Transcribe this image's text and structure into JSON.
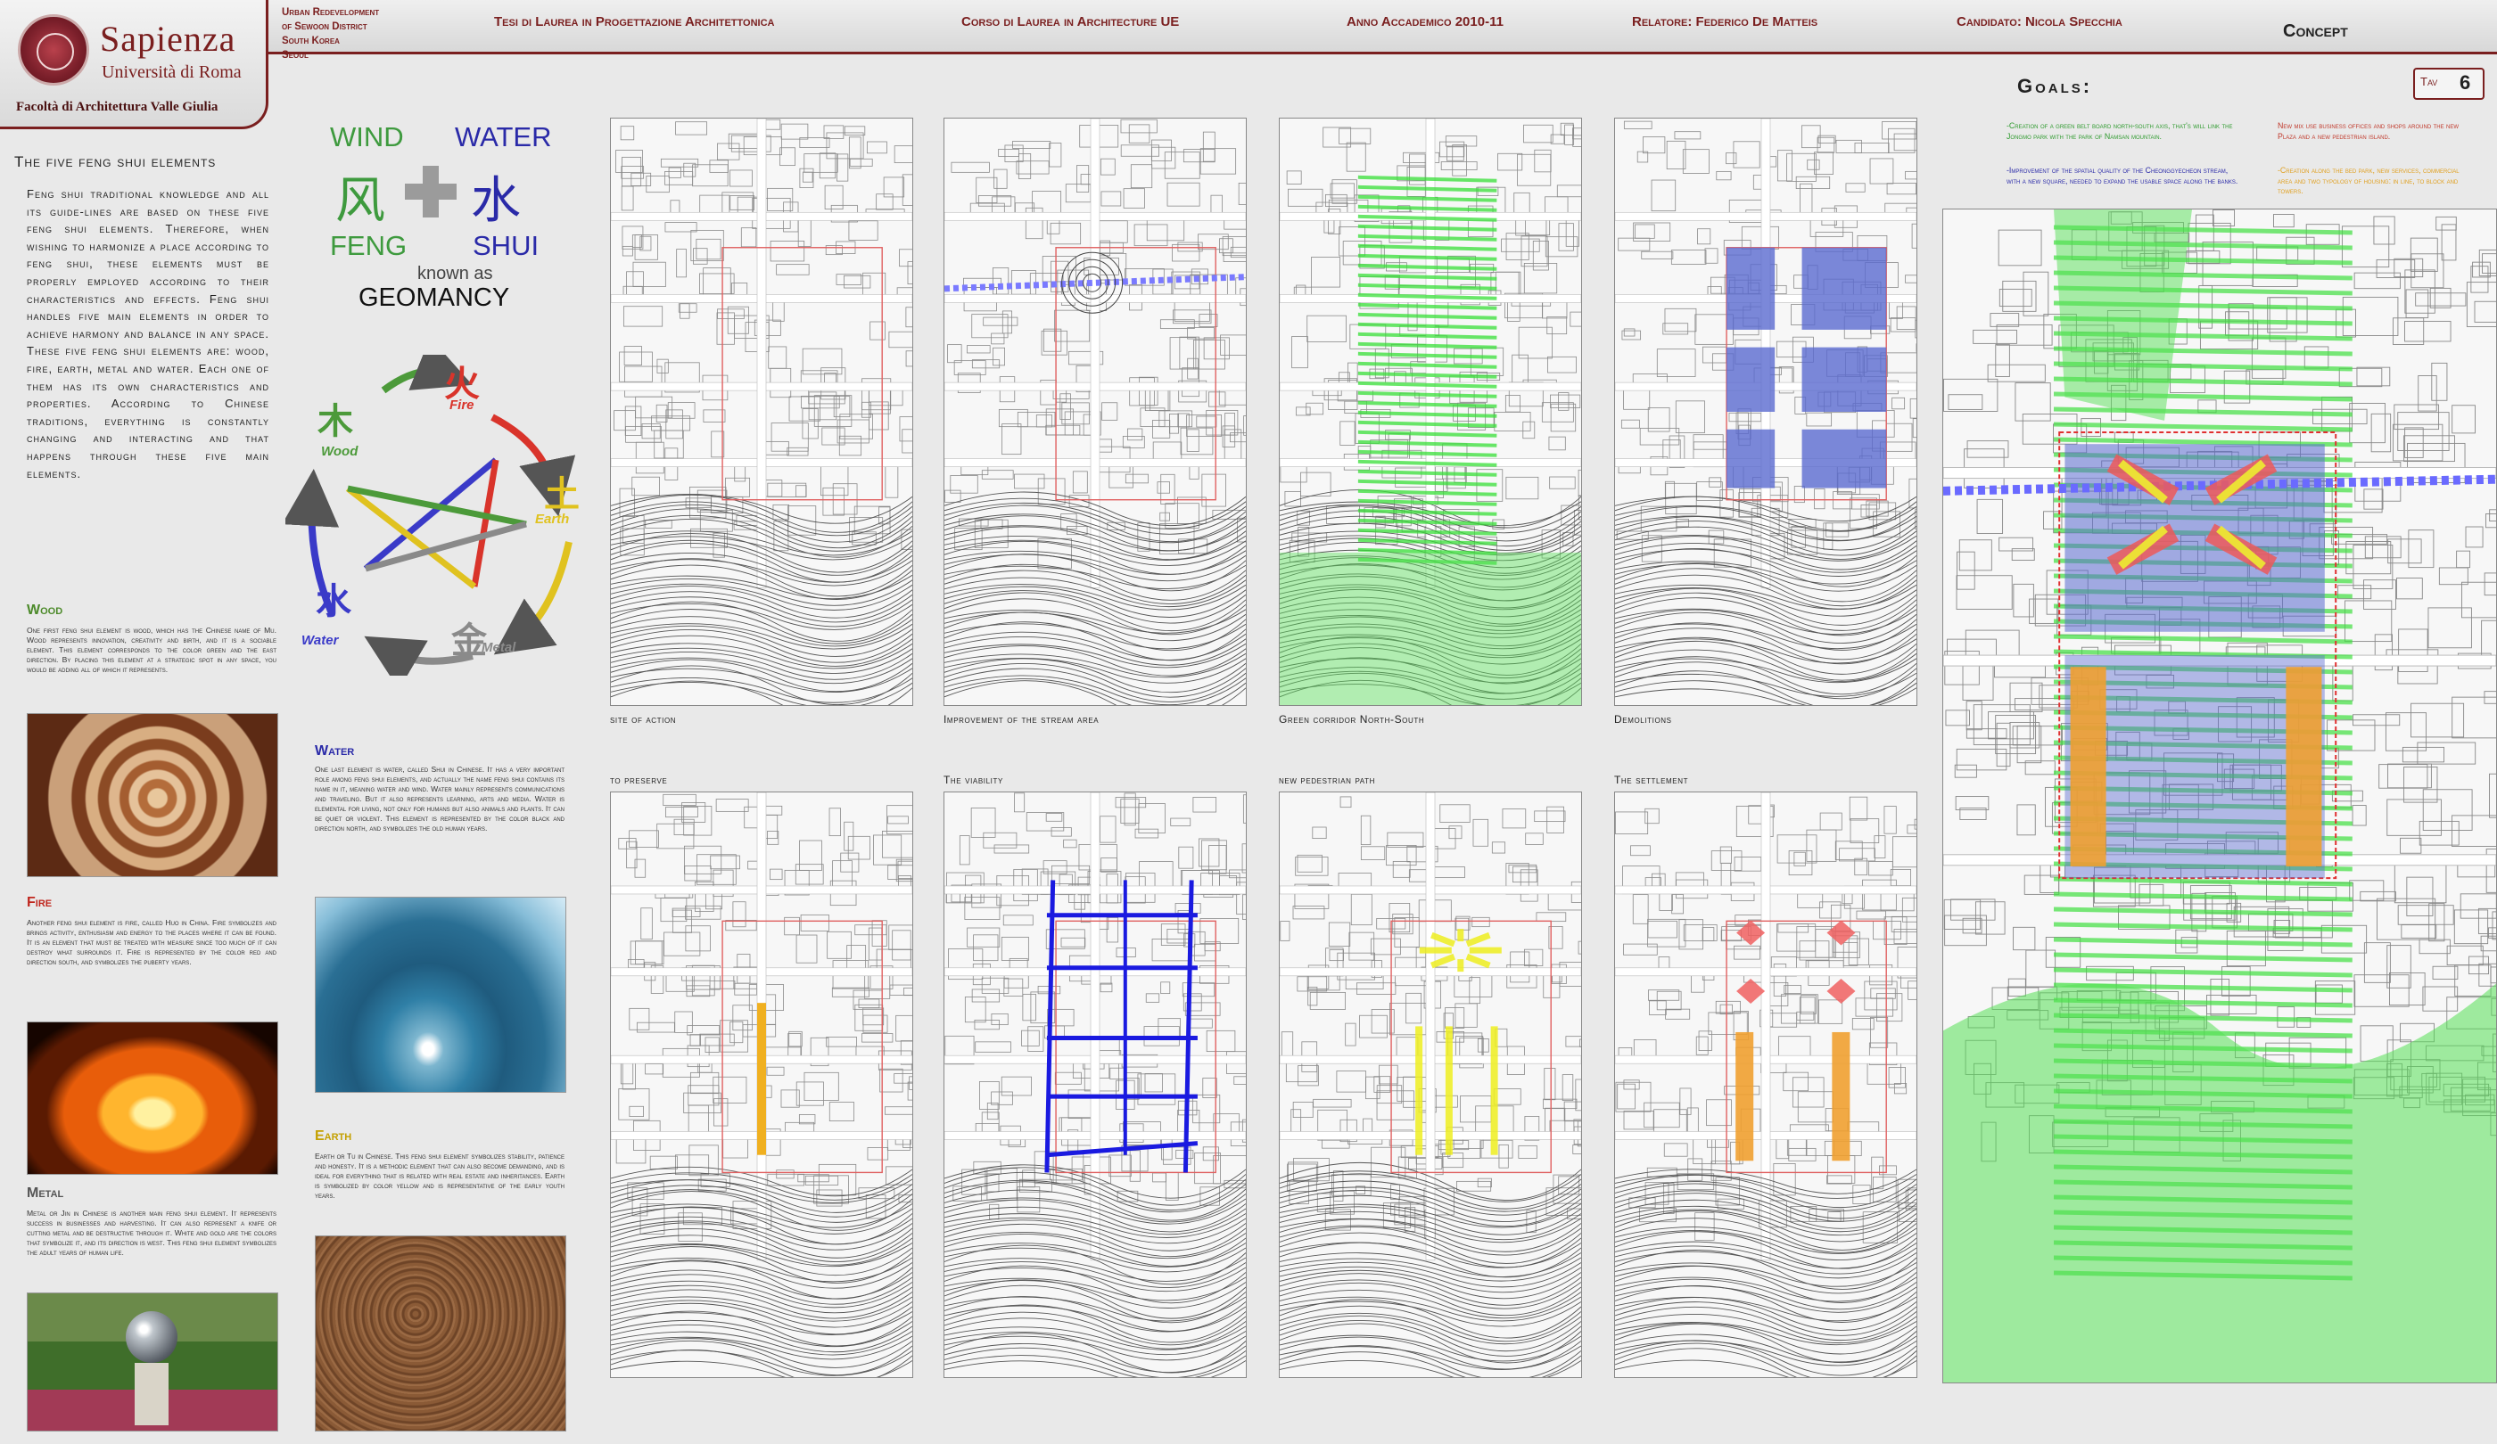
{
  "header": {
    "university": "Sapienza",
    "university_sub": "Università di Roma",
    "faculty": "Facoltà di Architettura Valle Giulia",
    "project_lines": [
      "Urban Redevelopment",
      "of Sewoon District",
      "South Korea",
      "Seoul"
    ],
    "thesis": "Tesi di Laurea in Progettazione Architettonica",
    "course": "Corso di Laurea in Architecture UE",
    "year": "Anno Accademico 2010-11",
    "advisor": "Relatore: Federico De Matteis",
    "candidate": "Candidato: Nicola Specchia",
    "section": "Concept",
    "tav_label": "Tav",
    "tav_number": "6"
  },
  "left": {
    "title": "The five feng shui elements",
    "intro": "Feng shui traditional knowledge and all its guide-lines are based on these five feng shui elements. Therefore, when wishing to harmonize a place according to feng shui, these elements must be properly employed according to their characteristics and effects. Feng shui handles five main elements in order to achieve harmony and balance in any space. These five feng shui elements are: wood, fire, earth, metal and water. Each one of them has its own characteristics and properties. According to Chinese traditions, everything is constantly changing and interacting and that happens through these five main elements.",
    "wood": {
      "title": "Wood",
      "text": "One first feng shui element is wood, which has the Chinese name of Mu. Wood represents innovation, creativity and birth, and it is a sociable element. This element corresponds to the color green and the east direction. By placing this element at a strategic spot in any space, you would be adding all of which it represents."
    },
    "fire": {
      "title": "Fire",
      "text": "Another feng shui element is fire, called Huo in China. Fire symbolizes and brings activity, enthusiasm and energy to the places where it can be found. It is an element that must be treated with measure since too much of it can destroy what surrounds it. Fire is represented by the color red and direction south, and symbolizes the puberty years."
    },
    "metal": {
      "title": "Metal",
      "text": "Metal or Jin in Chinese is another main feng shui element. It represents success in businesses and harvesting. It can also represent a knife or cutting metal and be destructive through it. White and gold are the colors that symbolize it, and its direction is west. This feng shui element symbolizes the adult years of human life."
    },
    "water": {
      "title": "Water",
      "text": "One last element is water, called Shui in Chinese. It has a very important role among feng shui elements, and actually the name feng shui contains its name in it, meaning water and wind. Water mainly represents communications and traveling. But it also represents learning, arts and media. Water is elemental for living, not only for humans but also animals and plants. It can be quiet or violent. This element is represented by the color black and direction north, and symbolizes the old human years."
    },
    "earth": {
      "title": "Earth",
      "text": "Earth or Tu in Chinese. This feng shui element symbolizes stability, patience and honesty. It is a methodic element that can also become demanding, and is ideal for everything that is related with real estate and inheritances. Earth is symbolized by color yellow and is representative of the early youth years."
    }
  },
  "windwater": {
    "wind": "WIND",
    "water": "WATER",
    "feng_cn": "风",
    "shui_cn": "水",
    "feng": "FENG",
    "shui": "SHUI",
    "known_as": "known as",
    "geomancy": "GEOMANCY"
  },
  "cycle": {
    "fire_cn": "火",
    "fire": "Fire",
    "earth_cn": "土",
    "earth": "Earth",
    "metal_cn": "金",
    "metal": "Metal",
    "water_cn": "水",
    "water": "Water",
    "wood_cn": "木",
    "wood": "Wood",
    "colors": {
      "fire": "#d9342b",
      "earth": "#e0c21f",
      "metal": "#8a8a8a",
      "water": "#3a3ac8",
      "wood": "#4c9a3a"
    }
  },
  "maps": {
    "captions": [
      "site of action",
      "Improvement of the stream area",
      "Green corridor North-South",
      "Demolitions",
      "to preserve",
      "The viability",
      "new pedestrian path",
      "The settlement"
    ]
  },
  "goals": {
    "title": "Goals:",
    "items": [
      {
        "text": "-Creation of a green belt board north-south axis, that's will link the Jongmo park with the park of Namsan mountain.",
        "color": "#2e9a2e"
      },
      {
        "text": "New mix use business offices and shops around the new Plaza and a new pedestrian island.",
        "color": "#c0392b"
      },
      {
        "text": "-Improvement of the spatial quality of the Cheonggyecheon stream, with a new square, needed to expand the usable space along the banks.",
        "color": "#2a2aa8"
      },
      {
        "text": "-Creation along the bed park, new services, commercial area and two typology of housing: in line, to block and towers.",
        "color": "#e0a020"
      }
    ]
  }
}
